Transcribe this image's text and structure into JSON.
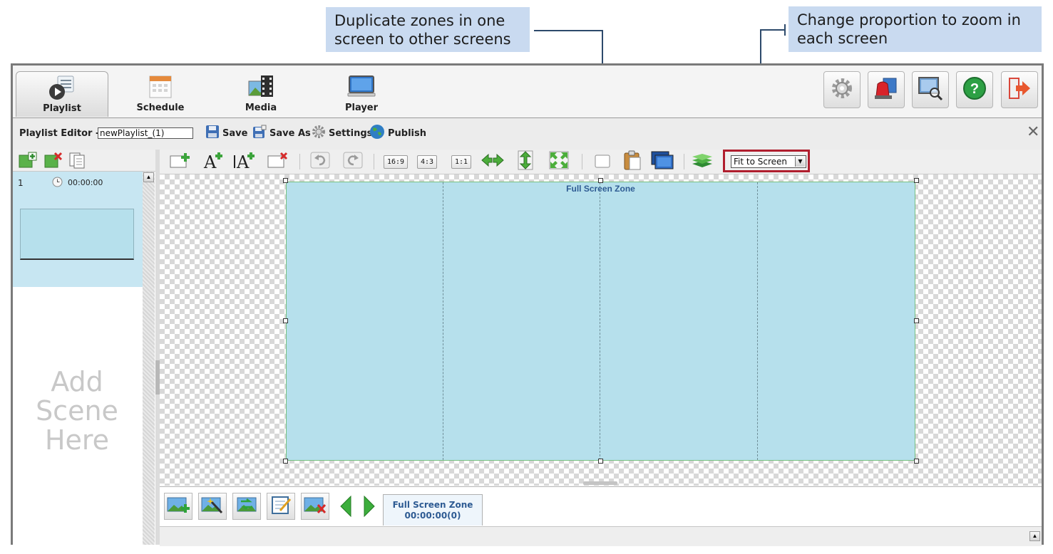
{
  "callouts": {
    "duplicate": "Duplicate zones in one screen to other screens",
    "zoom": "Change proportion to zoom in each screen"
  },
  "nav": {
    "tabs": [
      {
        "label": "Playlist",
        "icon": "playlist-icon",
        "active": true
      },
      {
        "label": "Schedule",
        "icon": "calendar-icon",
        "active": false
      },
      {
        "label": "Media",
        "icon": "media-icon",
        "active": false
      },
      {
        "label": "Player",
        "icon": "monitor-icon",
        "active": false
      }
    ],
    "right_buttons": [
      "settings-icon",
      "alarm-icon",
      "screen-search-icon",
      "help-icon",
      "logout-icon"
    ]
  },
  "editor": {
    "label": "Playlist Editor -",
    "playlist_name": "newPlaylist_(1)",
    "save": "Save",
    "save_as": "Save As",
    "settings": "Settings",
    "publish": "Publish"
  },
  "scenes": {
    "items": [
      {
        "index": "1",
        "time": "00:00:00"
      }
    ],
    "add_placeholder": "Add Scene Here"
  },
  "toolbar": {
    "ratios": [
      "16:9",
      "4:3",
      "1:1"
    ],
    "zoom_value": "Fit to Screen"
  },
  "zone": {
    "title": "Full Screen Zone",
    "divisions": 4
  },
  "bottom": {
    "zone_tab_title": "Full Screen Zone",
    "zone_tab_time": "00:00:00(0)"
  },
  "colors": {
    "zone_fill": "#b6e0ec",
    "highlight_border": "#b01e2e",
    "callout_bg": "#c9daf0",
    "scene_selected": "#c7e6f2"
  }
}
